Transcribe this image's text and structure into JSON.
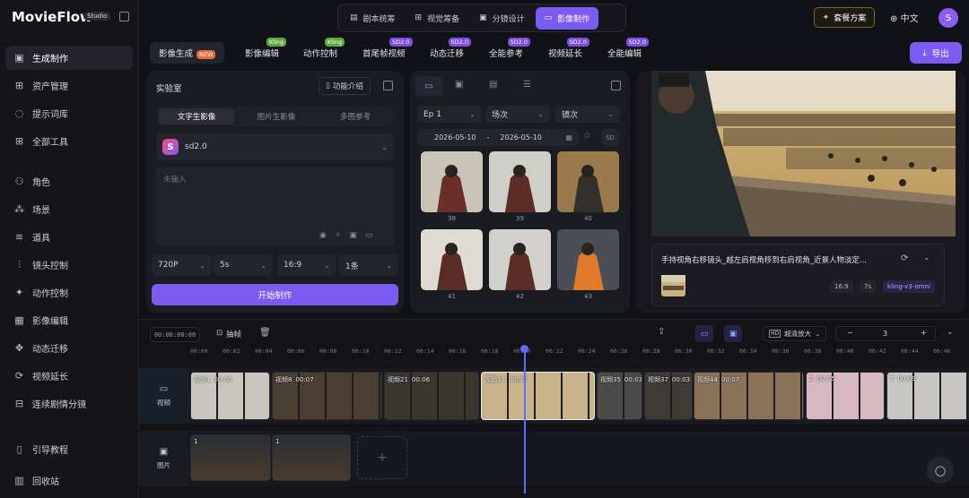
{
  "app": {
    "name": "MovieFlow",
    "edition": "Studio"
  },
  "sidebar": {
    "items": [
      {
        "label": "生成制作",
        "icon": "image-icon",
        "active": true
      },
      {
        "label": "资产管理",
        "icon": "grid-icon"
      },
      {
        "label": "提示词库",
        "icon": "lightbulb-icon"
      },
      {
        "label": "全部工具",
        "icon": "apps-icon"
      },
      {
        "label": "角色",
        "icon": "users-icon"
      },
      {
        "label": "场景",
        "icon": "cubes-icon"
      },
      {
        "label": "道具",
        "icon": "layers-icon"
      },
      {
        "label": "镜头控制",
        "icon": "sliders-icon"
      },
      {
        "label": "动作控制",
        "icon": "wand-icon"
      },
      {
        "label": "影像编辑",
        "icon": "film-icon"
      },
      {
        "label": "动态迁移",
        "icon": "move-icon"
      },
      {
        "label": "视频延长",
        "icon": "refresh-icon"
      },
      {
        "label": "连续剧情分镜",
        "icon": "storyboard-icon"
      },
      {
        "label": "引导教程",
        "icon": "book-icon"
      },
      {
        "label": "回收站",
        "icon": "trash-icon"
      }
    ]
  },
  "topnav": {
    "tabs": [
      {
        "label": "剧本统筹",
        "icon": "doc-icon"
      },
      {
        "label": "视觉筹备",
        "icon": "board-icon"
      },
      {
        "label": "分镜设计",
        "icon": "picture-icon"
      },
      {
        "label": "影像制作",
        "icon": "video-icon",
        "active": true
      }
    ]
  },
  "header": {
    "plan_label": "套餐方案",
    "lang": "中文",
    "avatar": "S",
    "export_label": "导出"
  },
  "feature_tabs": [
    {
      "label": "影像生成",
      "badge": "NEW",
      "badge_type": "new",
      "active": true
    },
    {
      "label": "影像编辑",
      "badge": "Kling",
      "badge_type": "kling"
    },
    {
      "label": "动作控制",
      "badge": "Kling",
      "badge_type": "kling"
    },
    {
      "label": "首尾帧视频",
      "badge": "SD2.0",
      "badge_type": "sd"
    },
    {
      "label": "动态迁移",
      "badge": "SD2.0",
      "badge_type": "sd"
    },
    {
      "label": "全能参考",
      "badge": "SD2.0",
      "badge_type": "sd"
    },
    {
      "label": "视频延长",
      "badge": "SD2.0",
      "badge_type": "sd"
    },
    {
      "label": "全能编辑",
      "badge": "SD2.0",
      "badge_type": "sd"
    }
  ],
  "lab": {
    "title": "实验室",
    "intro_button": "功能介绍",
    "modes": [
      "文字生影像",
      "图片生影像",
      "多图参考"
    ],
    "model": "sd2.0",
    "prompt_placeholder": "未输入",
    "options": {
      "resolution": "720P",
      "duration": "5s",
      "ratio": "16:9",
      "count": "1条"
    },
    "start_button": "开始制作"
  },
  "library": {
    "filters": {
      "episode": "Ep 1",
      "scene": "场次",
      "shot": "镜次"
    },
    "date_from": "2026-05-10",
    "date_sep": "-",
    "date_to": "2026-05-10",
    "sd_label": "SD",
    "thumbs": [
      "38",
      "39",
      "40",
      "41",
      "42",
      "43"
    ]
  },
  "preview": {
    "prompt": "手持视角右移镜头_越左肩视角移到右肩视角_近景人物淡定...",
    "tags": [
      "16:9",
      "7s",
      "kling-v3-omni"
    ]
  },
  "timeline": {
    "timecode": "00:00:00:00",
    "extract_label": "抽帧",
    "upscale_label": "超清放大",
    "upscale_value": "3",
    "ticks": [
      "00:00",
      "00:02",
      "00:04",
      "00:06",
      "00:08",
      "00:10",
      "00:12",
      "00:14",
      "00:16",
      "00:18",
      "00:20",
      "00:22",
      "00:24",
      "00:26",
      "00:28",
      "00:30",
      "00:32",
      "00:34",
      "00:36",
      "00:38",
      "00:40",
      "00:42",
      "00:44",
      "00:46"
    ],
    "video_track_label": "视频",
    "image_track_label": "图片",
    "video_clips": [
      {
        "name": "视频1",
        "dur": "00:05"
      },
      {
        "name": "视频8",
        "dur": "00:07"
      },
      {
        "name": "视频21",
        "dur": "00:06"
      },
      {
        "name": "视频17",
        "dur": "00:07"
      },
      {
        "name": "视频35",
        "dur": "00:03"
      },
      {
        "name": "视频37",
        "dur": "00:03"
      },
      {
        "name": "视频44",
        "dur": "00:07"
      },
      {
        "name": "2",
        "dur": "00:05"
      },
      {
        "name": "7",
        "dur": "00:09"
      }
    ],
    "image_clips": [
      "1",
      "1"
    ]
  },
  "colors": {
    "accent": "#7c5cf0",
    "bg": "#111118"
  }
}
